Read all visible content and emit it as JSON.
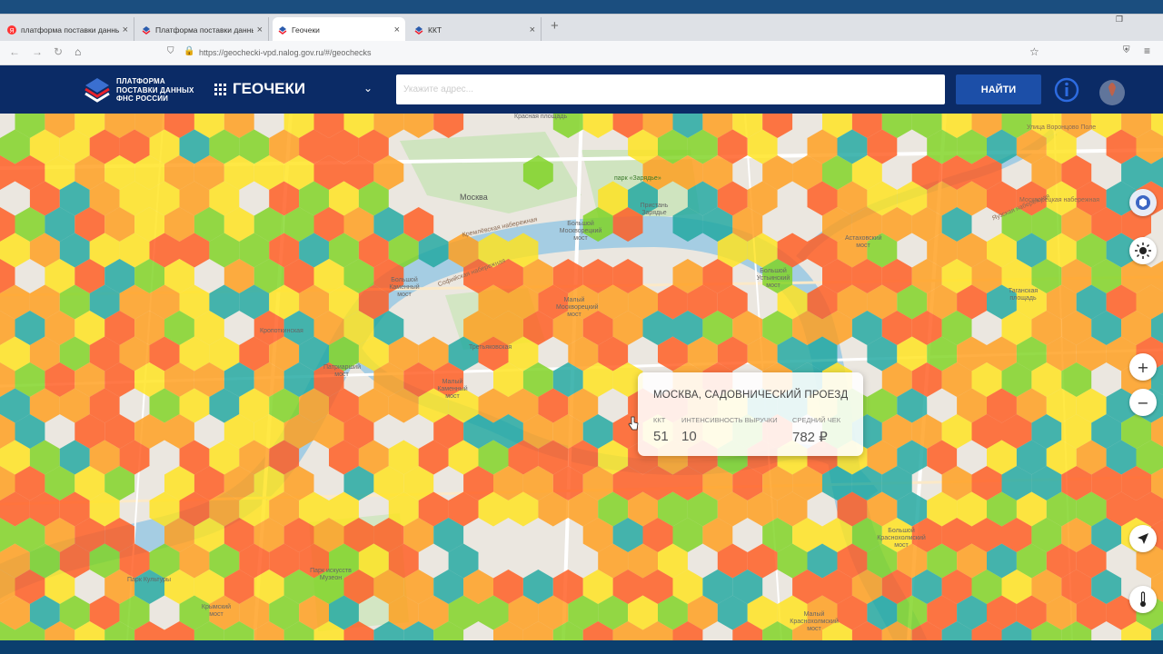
{
  "browser": {
    "tabs": [
      {
        "label": "платформа поставки данных",
        "icon": "yandex-icon",
        "active": false
      },
      {
        "label": "Платформа поставки данных",
        "icon": "fns-logo-icon",
        "active": false
      },
      {
        "label": "Геочеки",
        "icon": "fns-logo-icon",
        "active": true
      },
      {
        "label": "ККТ",
        "icon": "fns-logo-icon",
        "active": false
      }
    ],
    "new_tab": "+",
    "url": "https://geochecki-vpd.nalog.gov.ru/#/geochecks"
  },
  "header": {
    "brand_line1": "ПЛАТФОРМА",
    "brand_line2": "ПОСТАВКИ ДАННЫХ",
    "brand_line3": "ФНС РОССИИ",
    "section_title": "ГЕОЧЕКИ",
    "search_placeholder": "Укажите адрес...",
    "find_button": "НАЙТИ",
    "colors": {
      "header_bg": "#0b2b66",
      "button_bg": "#1c4fa8"
    }
  },
  "map": {
    "labels": [
      "Красная площадь",
      "Москва",
      "Большой Москворецкий мост",
      "парк «Зарядье»",
      "Пристань Зарядье",
      "Кремлёвская набережная",
      "Софийская набережная",
      "Большой Каменный мост",
      "Большой Устьинский мост",
      "Астаховский мост",
      "Таганская площадь",
      "Малый Москворецкий мост",
      "Третьяковская",
      "Патриарший мост",
      "Малый Каменный мост",
      "Кропоткинская",
      "Крымский мост",
      "Парк искусств Музеон",
      "Парк Культуры",
      "Большой Краснохолмский мост",
      "Малый Краснохолмский мост",
      "Яузская набережная",
      "Москворецкая набережная",
      "Улица Воронцово Поле"
    ],
    "legend_scale": [
      "#1ea7a0",
      "#7ed321",
      "#ffe31c",
      "#ff9e1b",
      "#ff5a1e"
    ]
  },
  "tooltip": {
    "title": "МОСКВА, САДОВНИЧЕСКИЙ ПРОЕЗД",
    "kkt_label": "ККТ",
    "kkt_value": "51",
    "intensity_label": "ИНТЕНСИВНОСТЬ ВЫРУЧКИ",
    "intensity_value": "10",
    "avg_label": "СРЕДНИЙ ЧЕК",
    "avg_value": "782 ₽"
  },
  "controls": {
    "zoom_in": "+",
    "zoom_out": "−"
  }
}
